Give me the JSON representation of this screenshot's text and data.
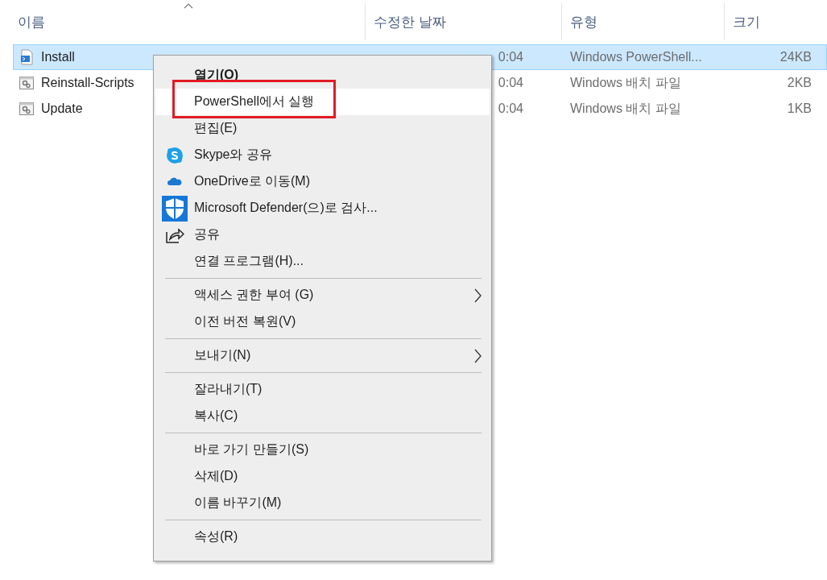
{
  "columns": [
    {
      "label": "이름",
      "sorted": true
    },
    {
      "label": "수정한 날짜",
      "sorted": false
    },
    {
      "label": "유형",
      "sorted": false
    },
    {
      "label": "크기",
      "sorted": false
    }
  ],
  "files": [
    {
      "name": "Install",
      "kind": "script",
      "date": "0:04",
      "type": "Windows PowerShell...",
      "size": "24KB",
      "selected": true
    },
    {
      "name": "Reinstall-Scripts",
      "kind": "batch",
      "date": "0:04",
      "type": "Windows 배치 파일",
      "size": "2KB",
      "selected": false
    },
    {
      "name": "Update",
      "kind": "batch",
      "date": "0:04",
      "type": "Windows 배치 파일",
      "size": "1KB",
      "selected": false
    }
  ],
  "context_menu": {
    "items": [
      {
        "kind": "item",
        "label": "열기(O)",
        "default": true,
        "selected": false,
        "boxed": false,
        "submenu": false
      },
      {
        "kind": "item",
        "label": "PowerShell에서 실행",
        "default": false,
        "selected": true,
        "boxed": true,
        "submenu": false
      },
      {
        "kind": "item",
        "label": "편집(E)",
        "default": false,
        "selected": false,
        "boxed": false,
        "submenu": false
      },
      {
        "kind": "skype",
        "label": "Skype와 공유",
        "default": false,
        "selected": false,
        "boxed": false,
        "submenu": false
      },
      {
        "kind": "cloud",
        "label": "OneDrive로 이동(M)",
        "default": false,
        "selected": false,
        "boxed": false,
        "submenu": false
      },
      {
        "kind": "shield",
        "label": "Microsoft Defender(으)로 검사...",
        "default": false,
        "selected": false,
        "boxed": false,
        "submenu": false
      },
      {
        "kind": "share",
        "label": "공유",
        "default": false,
        "selected": false,
        "boxed": false,
        "submenu": false
      },
      {
        "kind": "item",
        "label": "연결 프로그램(H)...",
        "default": false,
        "selected": false,
        "boxed": false,
        "submenu": false
      },
      {
        "kind": "separator"
      },
      {
        "kind": "item",
        "label": "액세스 권한 부여 (G)",
        "default": false,
        "selected": false,
        "boxed": false,
        "submenu": true
      },
      {
        "kind": "item",
        "label": "이전 버전 복원(V)",
        "default": false,
        "selected": false,
        "boxed": false,
        "submenu": false
      },
      {
        "kind": "separator"
      },
      {
        "kind": "item",
        "label": "보내기(N)",
        "default": false,
        "selected": false,
        "boxed": false,
        "submenu": true
      },
      {
        "kind": "separator"
      },
      {
        "kind": "item",
        "label": "잘라내기(T)",
        "default": false,
        "selected": false,
        "boxed": false,
        "submenu": false
      },
      {
        "kind": "item",
        "label": "복사(C)",
        "default": false,
        "selected": false,
        "boxed": false,
        "submenu": false
      },
      {
        "kind": "separator"
      },
      {
        "kind": "item",
        "label": "바로 가기 만들기(S)",
        "default": false,
        "selected": false,
        "boxed": false,
        "submenu": false
      },
      {
        "kind": "item",
        "label": "삭제(D)",
        "default": false,
        "selected": false,
        "boxed": false,
        "submenu": false
      },
      {
        "kind": "item",
        "label": "이름 바꾸기(M)",
        "default": false,
        "selected": false,
        "boxed": false,
        "submenu": false
      },
      {
        "kind": "separator"
      },
      {
        "kind": "item",
        "label": "속성(R)",
        "default": false,
        "selected": false,
        "boxed": false,
        "submenu": false
      }
    ]
  }
}
